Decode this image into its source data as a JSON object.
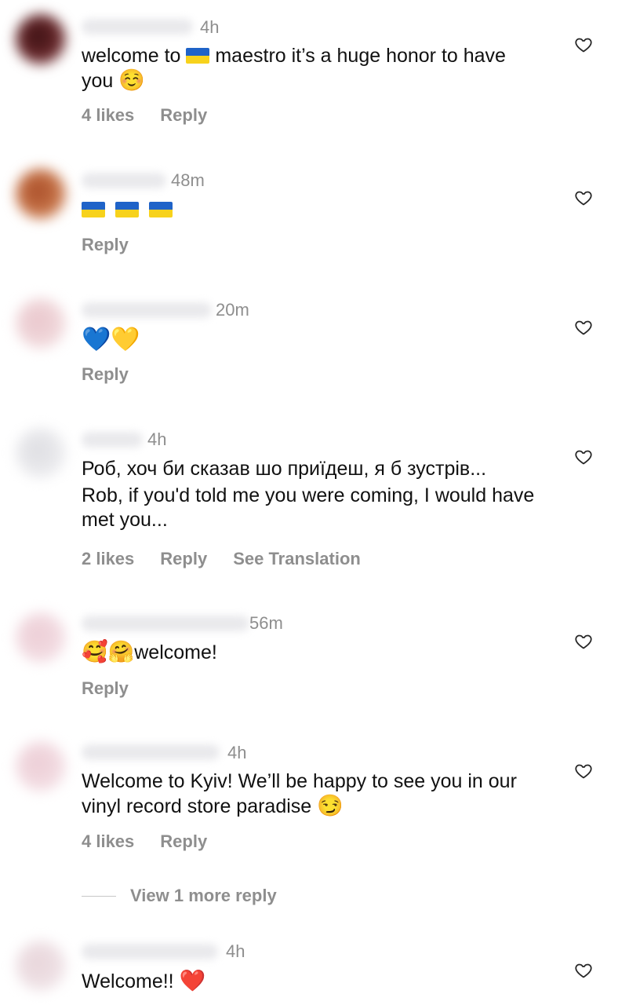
{
  "comments": [
    {
      "time": "4h",
      "text_parts": [
        "welcome to",
        "maestro it’s a huge honor to have you"
      ],
      "text_emoji": "☺️",
      "likes": "4 likes",
      "reply": "Reply",
      "avatar_color": "#5a1f22"
    },
    {
      "time": "48m",
      "reply": "Reply",
      "avatar_color": "#b9643c"
    },
    {
      "time": "20m",
      "text": "💙💛",
      "reply": "Reply",
      "avatar_color": "#f3d6da"
    },
    {
      "time": "4h",
      "text": "Роб, хоч би сказав шо приїдеш, я б зустрів...",
      "translation": "Rob, if you'd told me you were coming, I would have met you...",
      "likes": "2 likes",
      "reply": "Reply",
      "see_translation": "See Translation",
      "avatar_color": "#e7e7ea"
    },
    {
      "time": "56m",
      "emoji": "🥰🤗",
      "text": "welcome!",
      "reply": "Reply",
      "avatar_color": "#f4dde3"
    },
    {
      "time": "4h",
      "text": "Welcome to Kyiv! We’ll be happy to see you in our vinyl record store paradise",
      "text_emoji": "😏",
      "likes": "4 likes",
      "reply": "Reply",
      "avatar_color": "#f3dde3"
    },
    {
      "time": "4h",
      "text": "Welcome!!",
      "text_emoji": "❤️",
      "avatar_color": "#efe2e6"
    }
  ],
  "view_more": "View 1 more reply",
  "flag_colors": [
    "#1f63c8",
    "#f7d21c"
  ],
  "heart_icon": "heart-outline-icon"
}
